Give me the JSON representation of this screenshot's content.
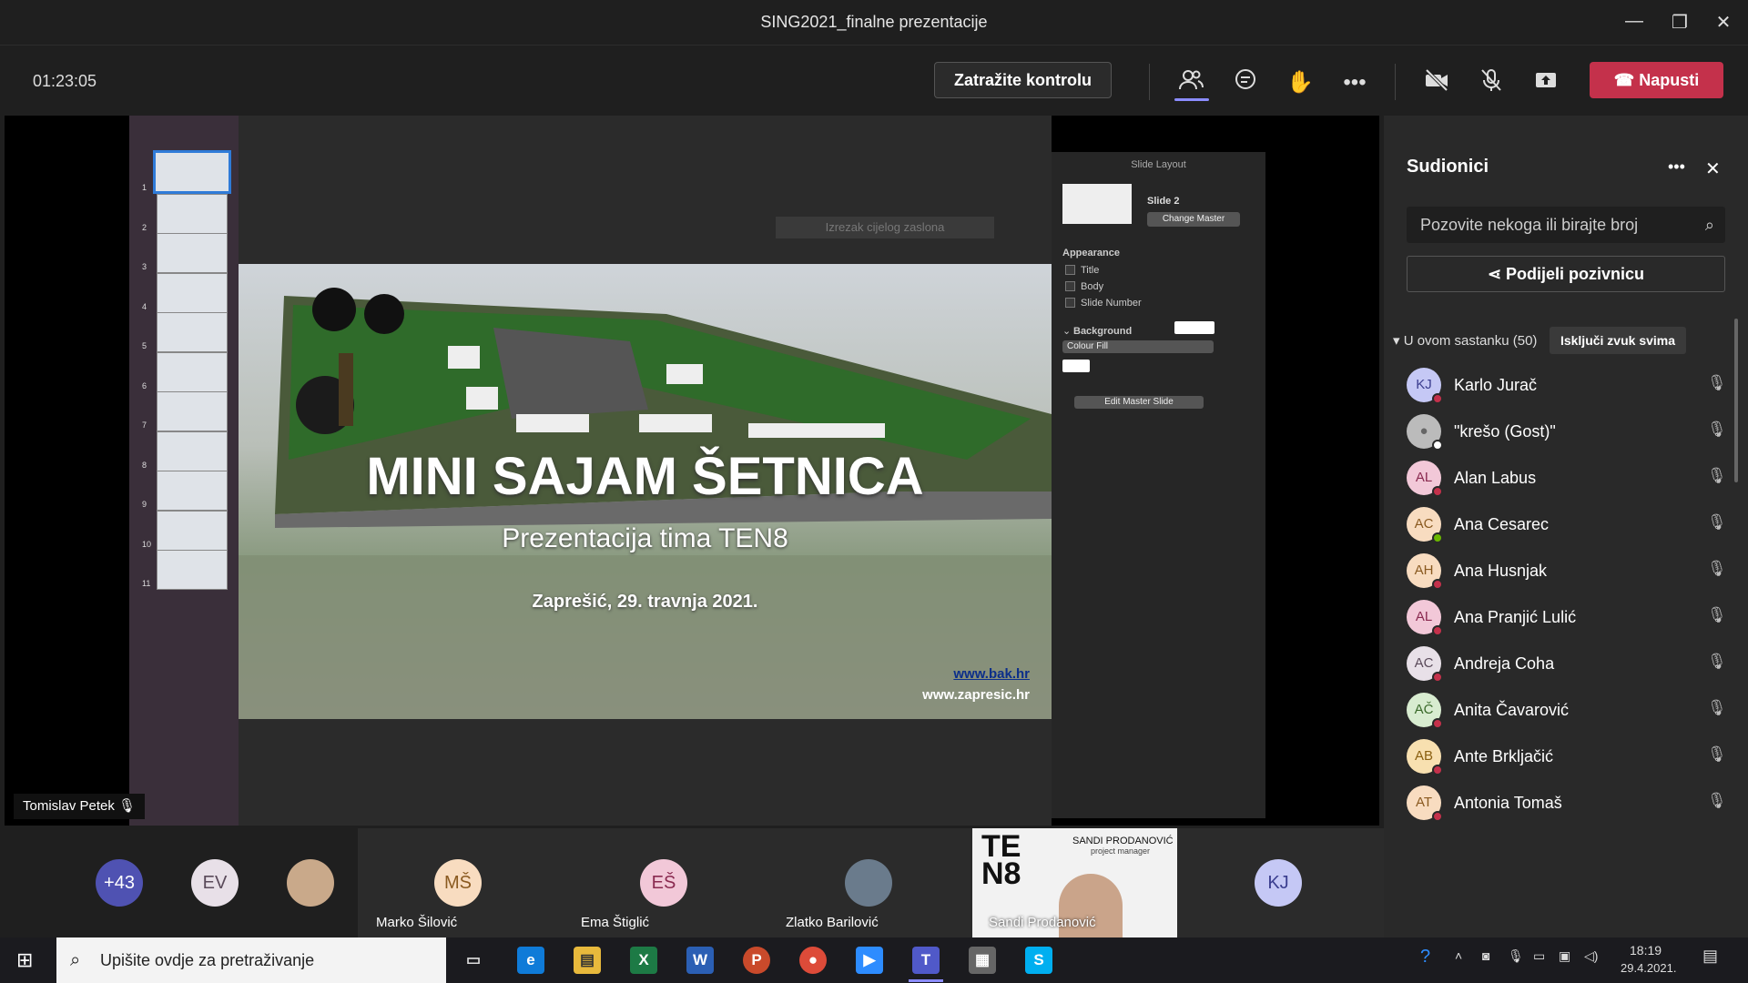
{
  "window": {
    "title": "SING2021_finalne prezentacije"
  },
  "toolbar": {
    "timer": "01:23:05",
    "request_control": "Zatražite kontrolu",
    "leave": "Napusti"
  },
  "slide": {
    "title": "MINI SAJAM ŠETNICA",
    "subtitle": "Prezentacija tima TEN8",
    "date": "Zaprešić, 29. travnja 2021.",
    "link1": "www.bak.hr",
    "link2": "www.zapresic.hr",
    "hint": "Izrezak cijelog zaslona"
  },
  "thumbnails": [
    "1",
    "2",
    "3",
    "4",
    "5",
    "6",
    "7",
    "8",
    "9",
    "10",
    "11"
  ],
  "layout_panel": {
    "header": "Slide Layout",
    "slide_name": "Slide 2",
    "change_master": "Change Master",
    "appearance": "Appearance",
    "title": "Title",
    "body": "Body",
    "slide_number": "Slide Number",
    "background": "Background",
    "colour_fill": "Colour Fill",
    "edit_master": "Edit Master Slide"
  },
  "presenter": "Tomislav Petek",
  "sidebar": {
    "title": "Sudionici",
    "search_placeholder": "Pozovite nekoga ili birajte broj",
    "share": "Podijeli pozivnicu",
    "section": "U ovom sastanku (50)",
    "mute_all": "Isključi zvuk svima",
    "participants": [
      {
        "initials": "KJ",
        "name": "Karlo Jurač",
        "bg": "#c5c8f5",
        "fg": "#3b3e8f",
        "status": "#c4314b"
      },
      {
        "initials": "",
        "name": "\"krešo (Gost)\"",
        "bg": "#bbbbbb",
        "fg": "#666666",
        "status": "#ffffff"
      },
      {
        "initials": "AL",
        "name": "Alan Labus",
        "bg": "#f2c8d8",
        "fg": "#8a2a50",
        "status": "#c4314b"
      },
      {
        "initials": "AC",
        "name": "Ana Cesarec",
        "bg": "#f8dcc0",
        "fg": "#8a5a20",
        "status": "#6bb700"
      },
      {
        "initials": "AH",
        "name": "Ana Husnjak",
        "bg": "#f8dcc0",
        "fg": "#8a5a20",
        "status": "#c4314b"
      },
      {
        "initials": "AL",
        "name": "Ana Pranjić Lulić",
        "bg": "#f2c8d8",
        "fg": "#8a2a50",
        "status": "#c4314b"
      },
      {
        "initials": "AC",
        "name": "Andreja Coha",
        "bg": "#e8e0e8",
        "fg": "#5a4a5a",
        "status": "#c4314b"
      },
      {
        "initials": "AČ",
        "name": "Anita Čavarović",
        "bg": "#d8ecd0",
        "fg": "#3a6a2a",
        "status": "#c4314b"
      },
      {
        "initials": "AB",
        "name": "Ante Brkljačić",
        "bg": "#f8e0b0",
        "fg": "#8a6010",
        "status": "#c4314b"
      },
      {
        "initials": "AT",
        "name": "Antonia Tomaš",
        "bg": "#f8dcc0",
        "fg": "#8a5a20",
        "status": "#c4314b"
      }
    ]
  },
  "strip": {
    "overflow": "+43",
    "ev": "EV",
    "ms_initials": "MŠ",
    "ms_name": "Marko Šilović",
    "es_initials": "EŠ",
    "es_name": "Ema Štiglić",
    "zb_name": "Zlatko Barilović",
    "sp_name": "Sandi Prodanović",
    "sp_card_name": "SANDI PRODANOVIĆ",
    "sp_card_role": "project manager",
    "sp_logo": "TE N8",
    "kj": "KJ"
  },
  "taskbar": {
    "search": "Upišite ovdje za pretraživanje",
    "time": "18:19",
    "date": "29.4.2021."
  }
}
